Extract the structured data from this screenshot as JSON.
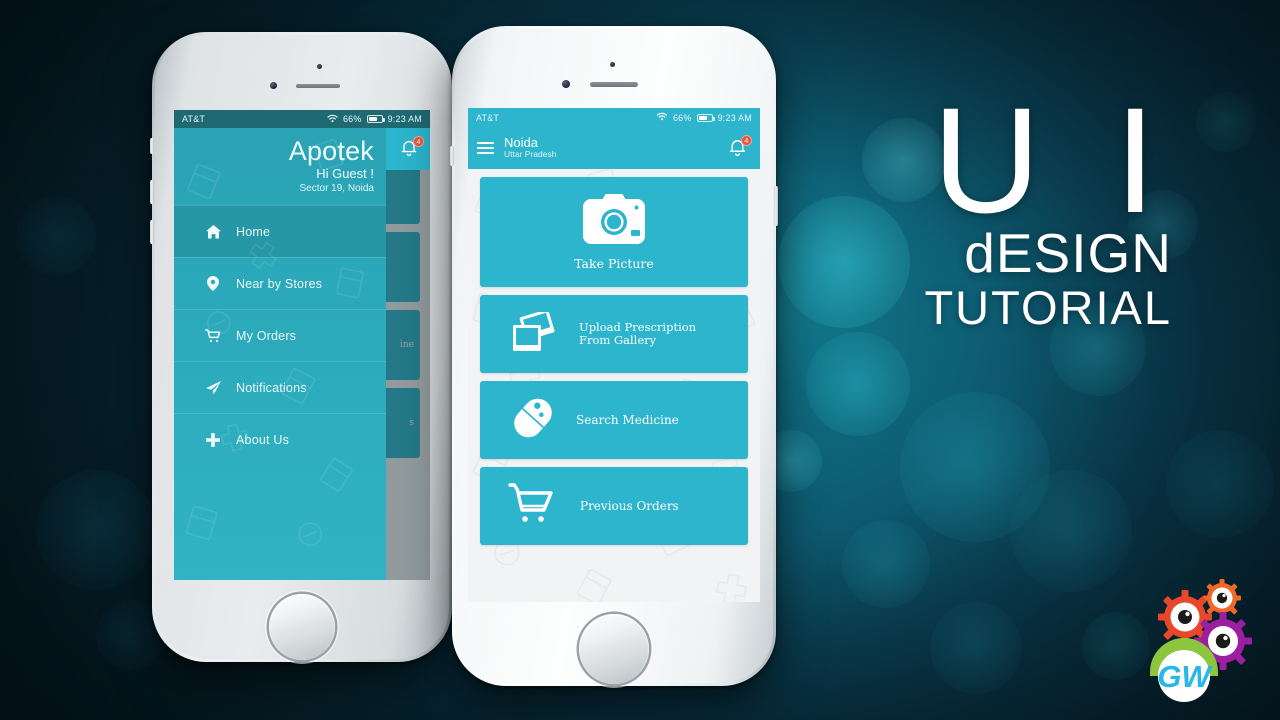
{
  "background": {
    "base_color": "#0a3c50",
    "accent_color": "#12788c",
    "dark_color": "#04161e"
  },
  "title_block": {
    "line1": "U I",
    "line2": "dESIGN",
    "line3": "TUTORIAL",
    "color": "#ffffff"
  },
  "logo": {
    "text": "GW",
    "text_color": "#29b6e8",
    "dome_color": "#8cc63f",
    "gear_colors": [
      "#e8472c",
      "#f0672a",
      "#9b1fa0"
    ]
  },
  "theme": {
    "teal": "#2cb5cd",
    "teal_dark": "#2aa3b4",
    "statusbar_right": "#2cb5cd",
    "statusbar_left": "#1e6a73",
    "badge_color": "#e8563f",
    "card_bg": "#2cb5cd",
    "content_bg": "#f2f3f4"
  },
  "statusbar": {
    "carrier": "AT&T",
    "wifi_icon": "wifi-icon",
    "battery_percent": "66%",
    "battery_icon": "battery-icon",
    "time": "9:23 AM"
  },
  "phone_left": {
    "label": "silver-iphone",
    "drawer": {
      "brand": "Apotek",
      "greeting": "Hi Guest !",
      "sector": "Sector 19, Noida",
      "items": [
        {
          "label": "Home",
          "icon": "home-icon",
          "active": true
        },
        {
          "label": "Near by Stores",
          "icon": "location-pin-icon",
          "active": false
        },
        {
          "label": "My Orders",
          "icon": "shopping-cart-icon",
          "active": false
        },
        {
          "label": "Notifications",
          "icon": "paper-plane-icon",
          "active": false
        },
        {
          "label": "About Us",
          "icon": "plus-cross-icon",
          "active": false
        }
      ]
    },
    "behind_partial_text": [
      "ine",
      "s"
    ]
  },
  "phone_right": {
    "label": "white-iphone",
    "appbar": {
      "menu_icon": "hamburger-menu-icon",
      "city": "Noida",
      "state": "Uttar Pradesh",
      "bell_icon": "notification-bell-icon",
      "badge_count": "4"
    },
    "cards": [
      {
        "label": "Take Picture",
        "icon": "camera-icon",
        "layout": "centered"
      },
      {
        "label": "Upload Prescription\nFrom Gallery",
        "icon": "photos-icon",
        "layout": "row"
      },
      {
        "label": "Search Medicine",
        "icon": "pill-capsule-icon",
        "layout": "row"
      },
      {
        "label": "Previous Orders",
        "icon": "shopping-cart-icon",
        "layout": "row"
      }
    ]
  }
}
